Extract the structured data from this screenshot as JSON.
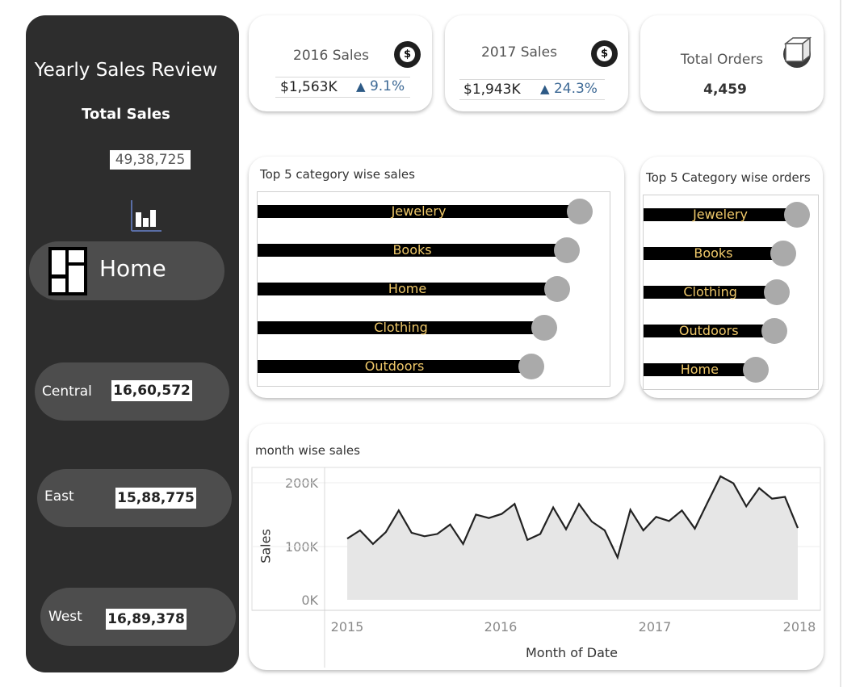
{
  "sidebar": {
    "title": "Yearly Sales Review",
    "total_sales_label": "Total Sales",
    "total_sales_value": "49,38,725",
    "chart_icon": "bar-chart-icon",
    "home_label": "Home",
    "home_icon": "dashboard-layout-icon",
    "regions": [
      {
        "name": "Central",
        "value": "16,60,572"
      },
      {
        "name": "East",
        "value": "15,88,775"
      },
      {
        "name": "West",
        "value": "16,89,378"
      }
    ]
  },
  "kpis": {
    "sales_2016": {
      "title": "2016 Sales",
      "value": "$1,563K",
      "change": "9.1%",
      "icon": "dollar-coin-icon"
    },
    "sales_2017": {
      "title": "2017 Sales",
      "value": "$1,943K",
      "change": "24.3%",
      "icon": "dollar-coin-icon"
    },
    "orders": {
      "title": "Total Orders",
      "value": "4,459",
      "icon": "box-icon"
    },
    "up_arrow": "▲"
  },
  "colors": {
    "sidebar_bg": "#2d2d2d",
    "pill_bg": "#4d4d4d",
    "bar": "#000000",
    "bar_label": "#f0c96a",
    "dot": "#aaaaaa",
    "change_text": "#3e6a96",
    "area_fill": "#e6e6e6",
    "line": "#222222"
  },
  "chart_data": [
    {
      "type": "bar",
      "title": "Top 5 category wise sales",
      "orientation": "horizontal",
      "categories": [
        "Jewelery",
        "Books",
        "Home",
        "Clothing",
        "Outdoors"
      ],
      "values": [
        100,
        96,
        93,
        89,
        85
      ]
    },
    {
      "type": "bar",
      "title": "Top 5 Category wise orders",
      "orientation": "horizontal",
      "categories": [
        "Jewelery",
        "Books",
        "Clothing",
        "Outdoors",
        "Home"
      ],
      "values": [
        100,
        91,
        87,
        85,
        73
      ]
    },
    {
      "type": "area",
      "title": "month wise sales",
      "xlabel": "Month of Date",
      "ylabel": "Sales",
      "x_ticks": [
        "2015",
        "2016",
        "2017",
        "2018"
      ],
      "y_ticks": [
        "0K",
        "100K",
        "200K"
      ],
      "ylim": [
        0,
        210000
      ],
      "x": [
        "2015-01",
        "2015-02",
        "2015-03",
        "2015-04",
        "2015-05",
        "2015-06",
        "2015-07",
        "2015-08",
        "2015-09",
        "2015-10",
        "2015-11",
        "2015-12",
        "2016-01",
        "2016-02",
        "2016-03",
        "2016-04",
        "2016-05",
        "2016-06",
        "2016-07",
        "2016-08",
        "2016-09",
        "2016-10",
        "2016-11",
        "2016-12",
        "2017-01",
        "2017-02",
        "2017-03",
        "2017-04",
        "2017-05",
        "2017-06",
        "2017-07",
        "2017-08",
        "2017-09",
        "2017-10",
        "2017-11",
        "2017-12"
      ],
      "series": [
        {
          "values": [
            104000,
            118000,
            95000,
            115000,
            152000,
            114000,
            108000,
            112000,
            128000,
            95000,
            145000,
            139000,
            146000,
            163000,
            102000,
            112000,
            157000,
            120000,
            163000,
            133000,
            118000,
            72000,
            153000,
            118000,
            141000,
            134000,
            152000,
            121000,
            166000,
            210000,
            198000,
            159000,
            190000,
            172000,
            175000,
            122000
          ]
        }
      ]
    }
  ]
}
